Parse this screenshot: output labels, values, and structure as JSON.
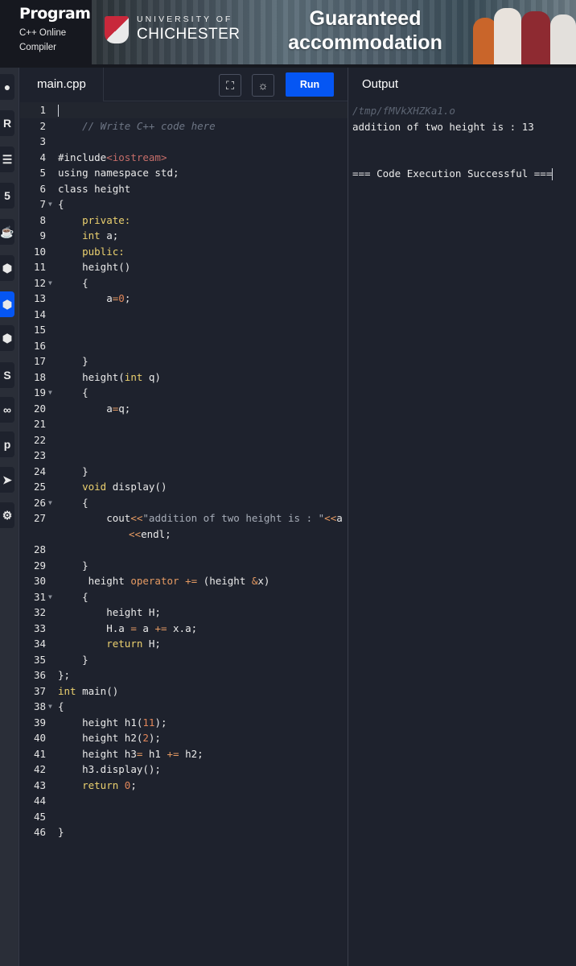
{
  "brand": {
    "name": "Programiz",
    "subtitle_line1": "C++ Online",
    "subtitle_line2": "Compiler"
  },
  "ad": {
    "university_top": "UNIVERSITY OF",
    "university_name": "CHICHESTER",
    "headline_line1": "Guaranteed",
    "headline_line2": "accommodation"
  },
  "sidebar": {
    "languages": [
      "python-icon",
      "r-icon",
      "sql-icon",
      "html-icon",
      "java-icon",
      "c-icon",
      "cpp-icon",
      "csharp-icon",
      "js-icon",
      "go-icon",
      "php-icon",
      "swift-icon",
      "rust-icon"
    ],
    "active": "cpp-icon"
  },
  "editor": {
    "tab": "main.cpp",
    "run_label": "Run",
    "lines": [
      {
        "n": "1"
      },
      {
        "n": "2"
      },
      {
        "n": "3"
      },
      {
        "n": "4"
      },
      {
        "n": "5"
      },
      {
        "n": "6"
      },
      {
        "n": "7"
      },
      {
        "n": "8"
      },
      {
        "n": "9"
      },
      {
        "n": "10"
      },
      {
        "n": "11"
      },
      {
        "n": "12"
      },
      {
        "n": "13"
      },
      {
        "n": "14"
      },
      {
        "n": "15"
      },
      {
        "n": "16"
      },
      {
        "n": "17"
      },
      {
        "n": "18"
      },
      {
        "n": "19"
      },
      {
        "n": "20"
      },
      {
        "n": "21"
      },
      {
        "n": "22"
      },
      {
        "n": "23"
      },
      {
        "n": "24"
      },
      {
        "n": "25"
      },
      {
        "n": "26"
      },
      {
        "n": "27"
      },
      {
        "n": "28"
      },
      {
        "n": "29"
      },
      {
        "n": "30"
      },
      {
        "n": "31"
      },
      {
        "n": "32"
      },
      {
        "n": "33"
      },
      {
        "n": "34"
      },
      {
        "n": "35"
      },
      {
        "n": "36"
      },
      {
        "n": "37"
      },
      {
        "n": "38"
      },
      {
        "n": "39"
      },
      {
        "n": "40"
      },
      {
        "n": "41"
      },
      {
        "n": "42"
      },
      {
        "n": "43"
      },
      {
        "n": "44"
      },
      {
        "n": "45"
      },
      {
        "n": "46"
      }
    ],
    "code": {
      "l2": "// Write C++ code here",
      "l4a": "#include",
      "l4b": "<iostream>",
      "l5": "using namespace std;",
      "l6": "class height",
      "l7": "{",
      "l8": "private:",
      "l9a": "int",
      "l9b": " a;",
      "l10": "public:",
      "l11": "height()",
      "l12": "{",
      "l13a": "a",
      "l13b": "=",
      "l13c": "0",
      "l13d": ";",
      "l17": "}",
      "l18a": "height(",
      "l18b": "int",
      "l18c": " q)",
      "l19": "{",
      "l20a": "a",
      "l20b": "=",
      "l20c": "q;",
      "l24": "}",
      "l25a": "void",
      "l25b": " display()",
      "l26": "{",
      "l27a": "cout",
      "l27b": "<<",
      "l27c": "\"addition of two height is : \"",
      "l27d": "<<",
      "l27e": "a",
      "l27f": "<<",
      "l27g": "endl;",
      "l29": "}",
      "l30a": "height ",
      "l30b": "operator",
      "l30c": " ",
      "l30d": "+=",
      "l30e": " (height ",
      "l30f": "&",
      "l30g": "x)",
      "l31": "{",
      "l32": "height H;",
      "l33a": "H.a ",
      "l33b": "=",
      "l33c": " a ",
      "l33d": "+=",
      "l33e": " x.a;",
      "l34a": "return",
      "l34b": " H;",
      "l35": "}",
      "l36": "};",
      "l37a": "int",
      "l37b": " main()",
      "l38": "{",
      "l39a": "height h1(",
      "l39b": "11",
      "l39c": ");",
      "l40a": "height h2(",
      "l40b": "2",
      "l40c": ");",
      "l41a": "height h3",
      "l41b": "=",
      "l41c": " h1 ",
      "l41d": "+=",
      "l41e": " h2;",
      "l42": "h3.display();",
      "l43a": "return",
      "l43b": " ",
      "l43c": "0",
      "l43d": ";",
      "l46": "}"
    }
  },
  "output": {
    "title": "Output",
    "path": "/tmp/fMVkXHZKa1.o",
    "result": "addition of two height is : 13",
    "status": "=== Code Execution Successful ==="
  },
  "colors": {
    "accent": "#0556f3",
    "background": "#1e222d",
    "keyword": "#ecd16f",
    "number": "#e0865a",
    "comment": "#6e7685"
  }
}
